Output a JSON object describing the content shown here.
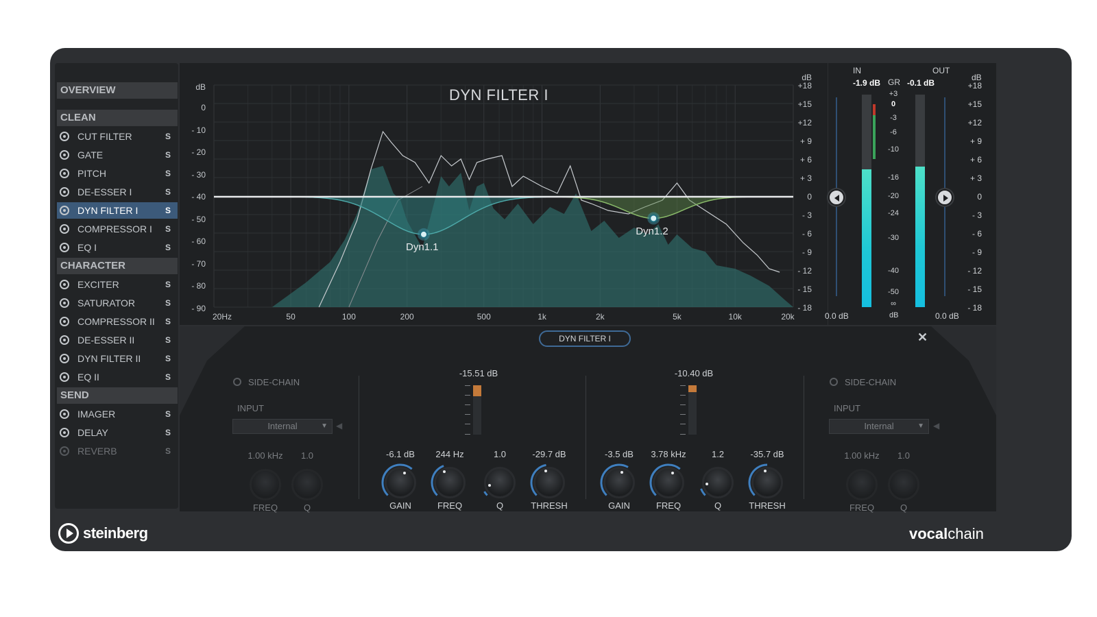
{
  "sidebar": {
    "overview": "OVERVIEW",
    "sections": [
      {
        "title": "CLEAN",
        "items": [
          {
            "label": "CUT FILTER",
            "solo": "S"
          },
          {
            "label": "GATE",
            "solo": "S"
          },
          {
            "label": "PITCH",
            "solo": "S"
          },
          {
            "label": "DE-ESSER I",
            "solo": "S"
          },
          {
            "label": "DYN FILTER I",
            "solo": "S",
            "active": true
          },
          {
            "label": "COMPRESSOR I",
            "solo": "S"
          },
          {
            "label": "EQ I",
            "solo": "S"
          }
        ]
      },
      {
        "title": "CHARACTER",
        "items": [
          {
            "label": "EXCITER",
            "solo": "S"
          },
          {
            "label": "SATURATOR",
            "solo": "S"
          },
          {
            "label": "COMPRESSOR II",
            "solo": "S"
          },
          {
            "label": "DE-ESSER II",
            "solo": "S"
          },
          {
            "label": "DYN FILTER II",
            "solo": "S"
          },
          {
            "label": "EQ II",
            "solo": "S"
          }
        ]
      },
      {
        "title": "SEND",
        "items": [
          {
            "label": "IMAGER",
            "solo": "S"
          },
          {
            "label": "DELAY",
            "solo": "S"
          },
          {
            "label": "REVERB",
            "solo": "S",
            "disabled": true
          }
        ]
      }
    ]
  },
  "graph": {
    "title": "DYN FILTER I",
    "left_unit": "dB",
    "left_scale": [
      "0",
      "- 10",
      "- 20",
      "- 30",
      "- 40",
      "- 50",
      "- 60",
      "- 70",
      "- 80",
      "- 90"
    ],
    "right_unit": "dB",
    "right_scale": [
      "+18",
      "+15",
      "+12",
      "+ 9",
      "+ 6",
      "+ 3",
      "0",
      "- 3",
      "- 6",
      "- 9",
      "- 12",
      "- 15",
      "- 18"
    ],
    "freq_labels": [
      "20Hz",
      "50",
      "100",
      "200",
      "500",
      "1k",
      "2k",
      "5k",
      "10k",
      "20k"
    ],
    "nodes": [
      {
        "label": "Dyn1.1",
        "freq_hz": 244,
        "gain_db": -6.1
      },
      {
        "label": "Dyn1.2",
        "freq_hz": 3780,
        "gain_db": -3.5
      }
    ]
  },
  "meters": {
    "in_label": "IN",
    "out_label": "OUT",
    "gr_label": "GR",
    "in_value": "-1.9 dB",
    "out_value": "-0.1 dB",
    "in_gain": "0.0 dB",
    "out_gain": "0.0 dB",
    "gr_scale": [
      "+3",
      "0",
      "-3",
      "-6",
      "-10",
      "-16",
      "-20",
      "-24",
      "-30",
      "-40",
      "-50",
      "∞"
    ],
    "gr_unit": "dB",
    "right_unit": "dB",
    "right_scale": [
      "+18",
      "+15",
      "+12",
      "+ 9",
      "+ 6",
      "+ 3",
      "0",
      "- 3",
      "- 6",
      "- 9",
      "- 12",
      "- 15",
      "- 18"
    ],
    "in_level": 0.65,
    "out_level": 0.66
  },
  "panel": {
    "title": "DYN FILTER I",
    "left_sidechain": {
      "label": "SIDE-CHAIN",
      "input_label": "INPUT",
      "input_value": "Internal",
      "freq_value": "1.00 kHz",
      "q_value": "1.0",
      "freq_label": "FREQ",
      "q_label": "Q"
    },
    "right_sidechain": {
      "label": "SIDE-CHAIN",
      "input_label": "INPUT",
      "input_value": "Internal",
      "freq_value": "1.00 kHz",
      "q_value": "1.0",
      "freq_label": "FREQ",
      "q_label": "Q"
    },
    "band1": {
      "gr_value": "-15.51 dB",
      "gain": "-6.1 dB",
      "freq": "244 Hz",
      "q": "1.0",
      "thresh": "-29.7 dB",
      "gain_label": "GAIN",
      "freq_label": "FREQ",
      "q_label": "Q",
      "thresh_label": "THRESH",
      "gr_level": 0.22
    },
    "band2": {
      "gr_value": "-10.40 dB",
      "gain": "-3.5 dB",
      "freq": "3.78 kHz",
      "q": "1.2",
      "thresh": "-35.7 dB",
      "gain_label": "GAIN",
      "freq_label": "FREQ",
      "q_label": "Q",
      "thresh_label": "THRESH",
      "gr_level": 0.14
    }
  },
  "footer": {
    "logo": "steinberg",
    "brand_bold": "vocal",
    "brand_rest": "chain"
  },
  "colors": {
    "accent": "#3f6a96",
    "meter": "#1ec7d6",
    "spectrum": "#2f6e6c",
    "gr": "#c47a3a"
  }
}
